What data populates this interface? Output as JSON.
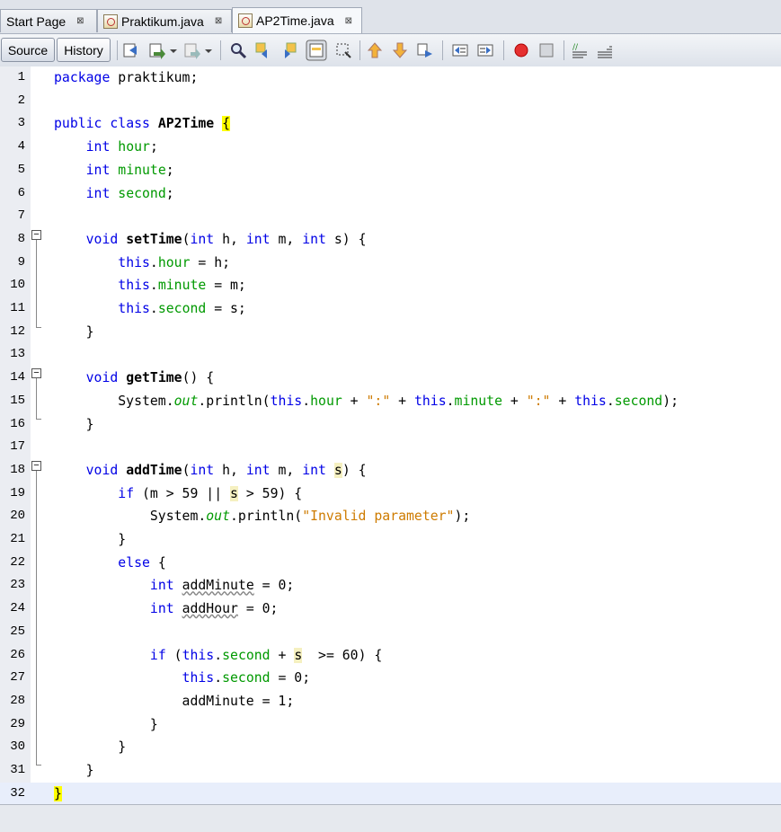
{
  "tabs": [
    {
      "label": "Start Page",
      "close": "⊠",
      "active": false,
      "icon": "none"
    },
    {
      "label": "Praktikum.java",
      "close": "⊠",
      "active": false,
      "icon": "java-file-icon"
    },
    {
      "label": "AP2Time.java",
      "close": "⊠",
      "active": true,
      "icon": "java-file-icon"
    }
  ],
  "toolbar": {
    "source_label": "Source",
    "history_label": "History"
  },
  "colors": {
    "keyword": "#0000e6",
    "field": "#009900",
    "string": "#ce7b00",
    "highlight": "#ffff00"
  },
  "lines": [
    {
      "n": "1",
      "t": "package praktikum;"
    },
    {
      "n": "2",
      "t": ""
    },
    {
      "n": "3",
      "t": "public class AP2Time {"
    },
    {
      "n": "4",
      "t": "    int hour;"
    },
    {
      "n": "5",
      "t": "    int minute;"
    },
    {
      "n": "6",
      "t": "    int second;"
    },
    {
      "n": "7",
      "t": ""
    },
    {
      "n": "8",
      "t": "    void setTime(int h, int m, int s) {"
    },
    {
      "n": "9",
      "t": "        this.hour = h;"
    },
    {
      "n": "10",
      "t": "        this.minute = m;"
    },
    {
      "n": "11",
      "t": "        this.second = s;"
    },
    {
      "n": "12",
      "t": "    }"
    },
    {
      "n": "13",
      "t": ""
    },
    {
      "n": "14",
      "t": "    void getTime() {"
    },
    {
      "n": "15",
      "t": "        System.out.println(this.hour + \":\" + this.minute + \":\" + this.second);"
    },
    {
      "n": "16",
      "t": "    }"
    },
    {
      "n": "17",
      "t": ""
    },
    {
      "n": "18",
      "t": "    void addTime(int h, int m, int s) {"
    },
    {
      "n": "19",
      "t": "        if (m > 59 || s > 59) {"
    },
    {
      "n": "20",
      "t": "            System.out.println(\"Invalid parameter\");"
    },
    {
      "n": "21",
      "t": "        }"
    },
    {
      "n": "22",
      "t": "        else {"
    },
    {
      "n": "23",
      "t": "            int addMinute = 0;"
    },
    {
      "n": "24",
      "t": "            int addHour = 0;"
    },
    {
      "n": "25",
      "t": ""
    },
    {
      "n": "26",
      "t": "            if (this.second + s  >= 60) {"
    },
    {
      "n": "27",
      "t": "                this.second = 0;"
    },
    {
      "n": "28",
      "t": "                addMinute = 1;"
    },
    {
      "n": "29",
      "t": "            }"
    },
    {
      "n": "30",
      "t": "        }"
    },
    {
      "n": "31",
      "t": "    }"
    },
    {
      "n": "32",
      "t": "}"
    }
  ]
}
